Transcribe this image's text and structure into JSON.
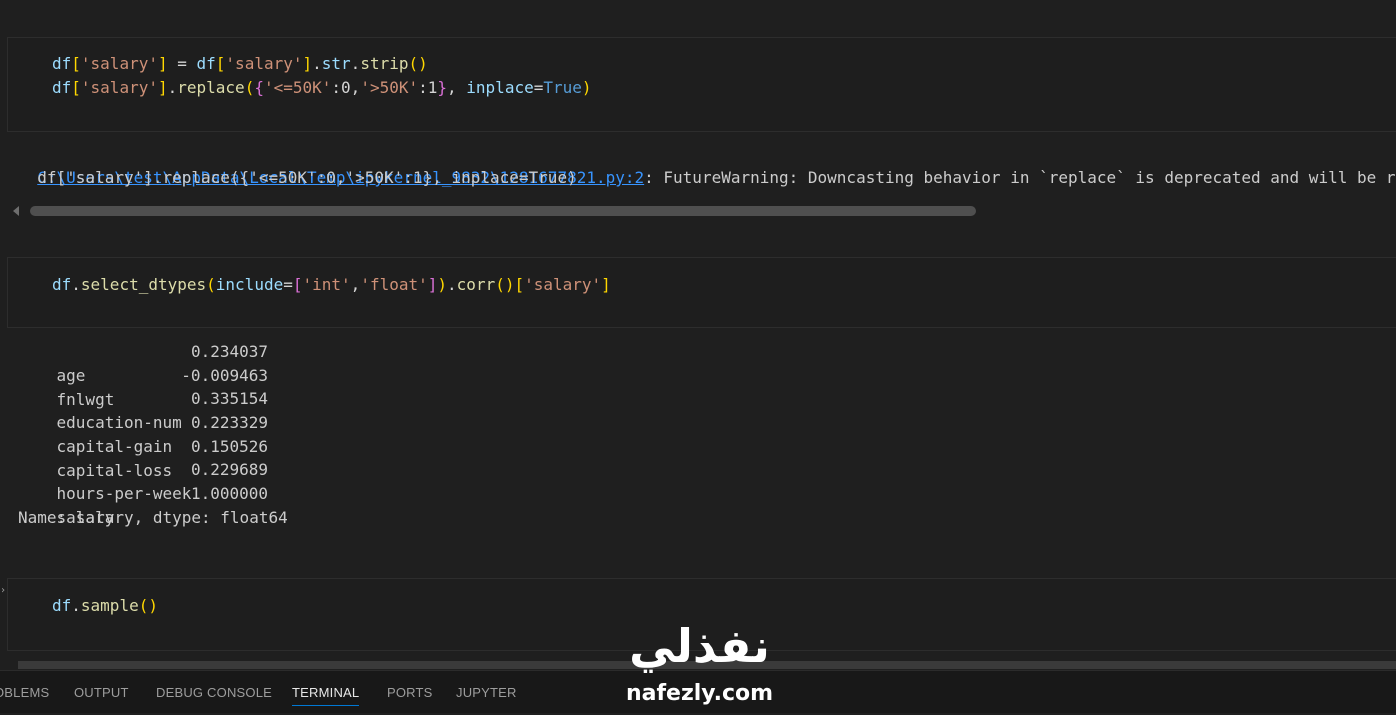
{
  "cells": [
    {
      "code_lines": [
        "df['salary'] = df['salary'].str.strip()",
        "df['salary'].replace({'<=50K':0,'>50K':1}, inplace=True)"
      ],
      "output": {
        "warning_link": "C:\\Users\\test\\AppData\\Local\\Temp\\ipykernel_9832\\1281677821.py:2",
        "warning_text": ": FutureWarning: Downcasting behavior in `replace` is deprecated and will be remo",
        "warning_line2": "  df['salary'].replace({'<=50K':0,'>50K':1}, inplace=True)"
      }
    },
    {
      "code_lines": [
        "df.select_dtypes(include=['int','float']).corr()['salary']"
      ],
      "output": {
        "series": [
          {
            "label": "age",
            "value": "0.234037"
          },
          {
            "label": "fnlwgt",
            "value": "-0.009463"
          },
          {
            "label": "education-num",
            "value": "0.335154"
          },
          {
            "label": "capital-gain",
            "value": "0.223329"
          },
          {
            "label": "capital-loss",
            "value": "0.150526"
          },
          {
            "label": "hours-per-week",
            "value": "0.229689"
          },
          {
            "label": "salary",
            "value": "1.000000"
          }
        ],
        "footer": "Name: salary, dtype: float64"
      }
    },
    {
      "code_lines": [
        "df.sample()"
      ]
    }
  ],
  "panel_tabs": [
    {
      "label": "OBLEMS",
      "active": false
    },
    {
      "label": "OUTPUT",
      "active": false
    },
    {
      "label": "DEBUG CONSOLE",
      "active": false
    },
    {
      "label": "TERMINAL",
      "active": true
    },
    {
      "label": "PORTS",
      "active": false
    },
    {
      "label": "JUPYTER",
      "active": false
    }
  ],
  "watermark": {
    "arabic": "نفذلي",
    "latin": "nafezly.com"
  },
  "colors": {
    "keyword": "#569cd6",
    "string": "#ce9178",
    "link": "#3794ff",
    "active_tab_underline": "#0078d4"
  }
}
